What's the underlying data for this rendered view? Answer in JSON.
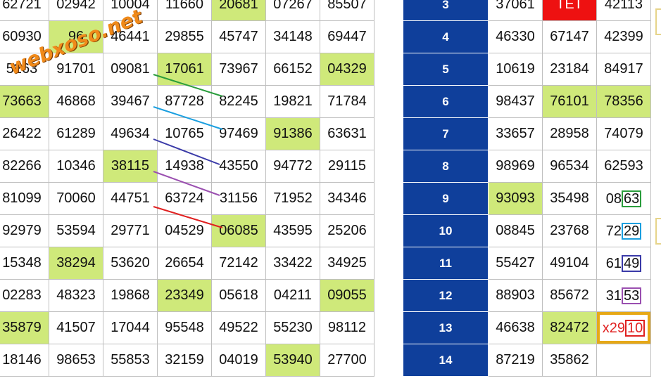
{
  "watermark": "webxoso.net",
  "left_rows": [
    [
      "62721",
      "02942",
      "10004",
      "11660",
      "20681",
      "07267",
      "85507"
    ],
    [
      "60930",
      "96",
      "46441",
      "29855",
      "45747",
      "34148",
      "69447"
    ],
    [
      "5263",
      "91701",
      "09081",
      "17061",
      "73967",
      "66152",
      "04329"
    ],
    [
      "73663",
      "46868",
      "39467",
      "87728",
      "82245",
      "19821",
      "71784"
    ],
    [
      "26422",
      "61289",
      "49634",
      "10765",
      "97469",
      "91386",
      "63631"
    ],
    [
      "82266",
      "10346",
      "38115",
      "14938",
      "43550",
      "94772",
      "29115"
    ],
    [
      "81099",
      "70060",
      "44751",
      "63724",
      "31156",
      "71952",
      "34346"
    ],
    [
      "92979",
      "53594",
      "29771",
      "04529",
      "06085",
      "43595",
      "25206"
    ],
    [
      "15348",
      "38294",
      "53620",
      "26654",
      "72142",
      "33422",
      "34925"
    ],
    [
      "02283",
      "48323",
      "19868",
      "23349",
      "05618",
      "04211",
      "09055"
    ],
    [
      "35879",
      "41507",
      "17044",
      "95548",
      "49522",
      "55230",
      "98112"
    ],
    [
      "18146",
      "98653",
      "55853",
      "32159",
      "04019",
      "53940",
      "27700"
    ]
  ],
  "left_highlights": [
    [
      0,
      4
    ],
    [
      1,
      1
    ],
    [
      2,
      3
    ],
    [
      2,
      6
    ],
    [
      3,
      0
    ],
    [
      4,
      5
    ],
    [
      5,
      2
    ],
    [
      7,
      4
    ],
    [
      8,
      1
    ],
    [
      9,
      3
    ],
    [
      9,
      6
    ],
    [
      10,
      0
    ],
    [
      11,
      5
    ]
  ],
  "right_rows": [
    {
      "idx": "3",
      "a": "37061",
      "b": "TẾT",
      "c": "42113"
    },
    {
      "idx": "4",
      "a": "46330",
      "b": "67147",
      "c": "42399"
    },
    {
      "idx": "5",
      "a": "10619",
      "b": "23184",
      "c": "84917"
    },
    {
      "idx": "6",
      "a": "98437",
      "b": "76101",
      "c": "78356"
    },
    {
      "idx": "7",
      "a": "33657",
      "b": "28958",
      "c": "74079"
    },
    {
      "idx": "8",
      "a": "98969",
      "b": "96534",
      "c": "62593"
    },
    {
      "idx": "9",
      "a": "93093",
      "b": "35498",
      "c_pre": "08",
      "c_box": "63"
    },
    {
      "idx": "10",
      "a": "08845",
      "b": "23768",
      "c_pre": "72",
      "c_box": "29"
    },
    {
      "idx": "11",
      "a": "55427",
      "b": "49104",
      "c_pre": "61",
      "c_box": "49"
    },
    {
      "idx": "12",
      "a": "88903",
      "b": "85672",
      "c_pre": "31",
      "c_box": "53"
    },
    {
      "idx": "13",
      "a": "46638",
      "b": "82472",
      "c_pre": "x29",
      "c_box": "10"
    },
    {
      "idx": "14",
      "a": "87219",
      "b": "35862",
      "c": ""
    }
  ],
  "right_highlights": [
    "3.b",
    "3.c",
    "6.a",
    "10.b"
  ],
  "box_colors": [
    "#2a9d3c",
    "#1a9fe0",
    "#3a3aa8",
    "#9a4fb0",
    "#e02020"
  ],
  "line_colors": [
    "#2a9d3c",
    "#1a9fe0",
    "#3a3aa8",
    "#9a4fb0",
    "#e02020"
  ]
}
